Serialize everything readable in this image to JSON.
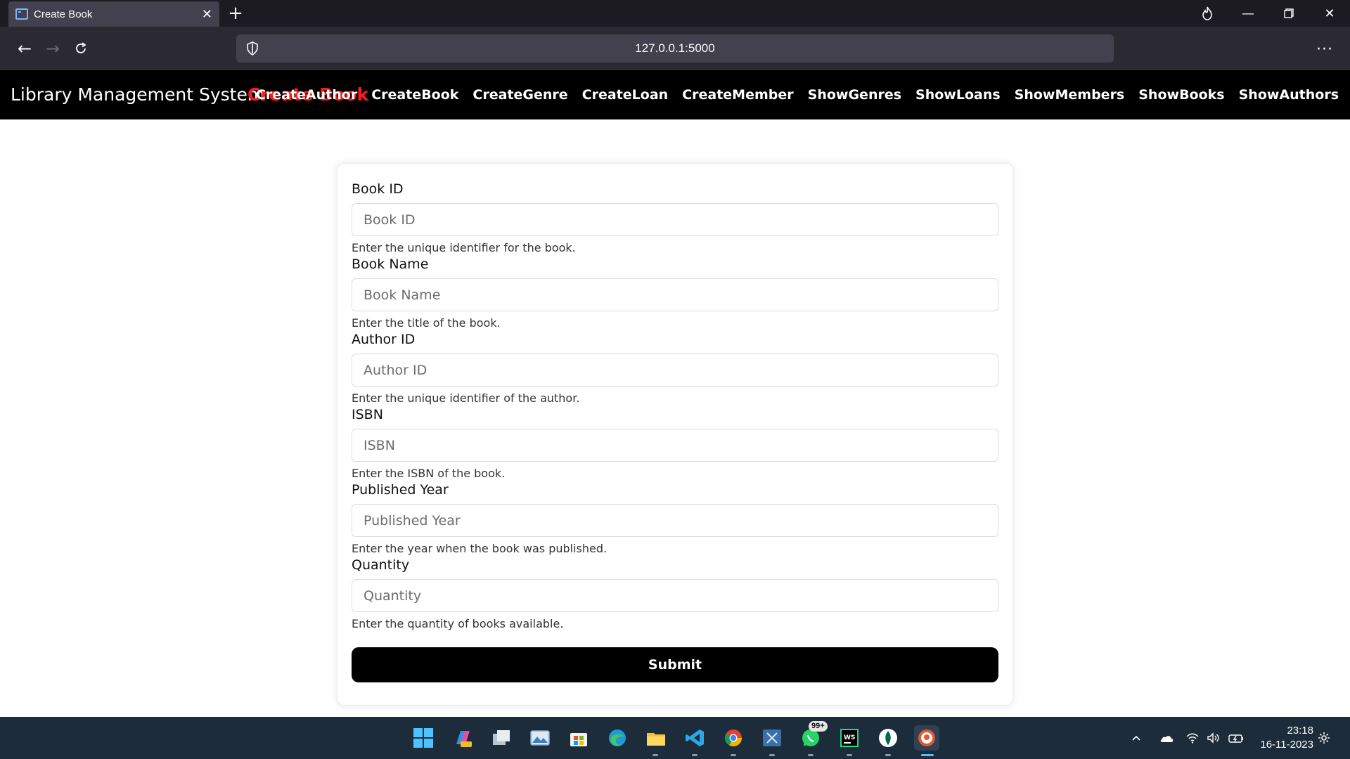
{
  "browser": {
    "tab_title": "Create Book",
    "tab_close_icon": "close-icon",
    "new_tab_icon": "plus-icon",
    "url": "127.0.0.1:5000",
    "menu_glyph": "···"
  },
  "navbar": {
    "brand": "Library Management System",
    "current_page": "Create Book",
    "links": [
      "CreateAuthor",
      "CreateBook",
      "CreateGenre",
      "CreateLoan",
      "CreateMember",
      "ShowGenres",
      "ShowLoans",
      "ShowMembers",
      "ShowBooks",
      "ShowAuthors"
    ]
  },
  "form": {
    "fields": [
      {
        "label": "Book ID",
        "placeholder": "Book ID",
        "value": "",
        "help": "Enter the unique identifier for the book."
      },
      {
        "label": "Book Name",
        "placeholder": "Book Name",
        "value": "",
        "help": "Enter the title of the book."
      },
      {
        "label": "Author ID",
        "placeholder": "Author ID",
        "value": "",
        "help": "Enter the unique identifier of the author."
      },
      {
        "label": "ISBN",
        "placeholder": "ISBN",
        "value": "",
        "help": "Enter the ISBN of the book."
      },
      {
        "label": "Published Year",
        "placeholder": "Published Year",
        "value": "",
        "help": "Enter the year when the book was published."
      },
      {
        "label": "Quantity",
        "placeholder": "Quantity",
        "value": "",
        "help": "Enter the quantity of books available."
      }
    ],
    "submit_label": "Submit"
  },
  "taskbar": {
    "whatsapp_badge": "99+",
    "time": "23:18",
    "date": "16-11-2023"
  },
  "colors": {
    "navbar_bg": "#000000",
    "current_page": "#ff1a1a",
    "submit_bg": "#000000",
    "taskbar_bg": "#1c2c3a"
  }
}
